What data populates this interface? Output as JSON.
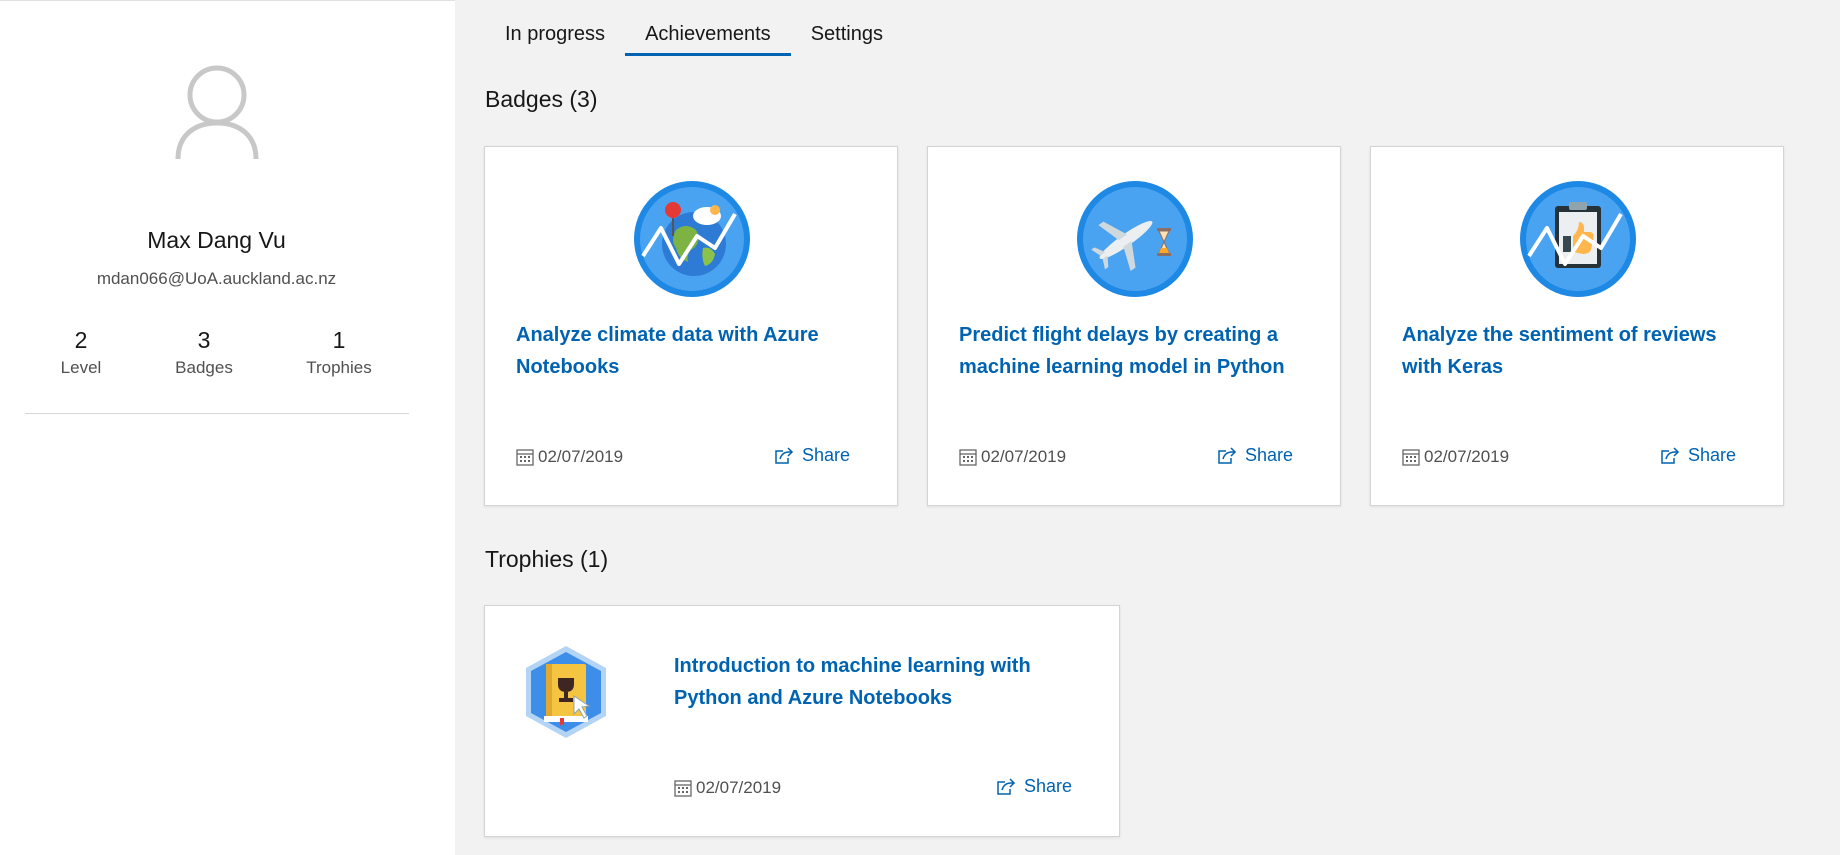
{
  "profile": {
    "name": "Max Dang Vu",
    "email": "mdan066@UoA.auckland.ac.nz",
    "stats": [
      {
        "value": "2",
        "label": "Level"
      },
      {
        "value": "3",
        "label": "Badges"
      },
      {
        "value": "1",
        "label": "Trophies"
      }
    ]
  },
  "tabs": [
    {
      "label": "In progress",
      "active": false
    },
    {
      "label": "Achievements",
      "active": true
    },
    {
      "label": "Settings",
      "active": false
    }
  ],
  "badges": {
    "heading": "Badges (3)",
    "items": [
      {
        "title": "Analyze climate data with Azure Notebooks",
        "date": "02/07/2019",
        "share": "Share",
        "icon": "climate-globe-icon"
      },
      {
        "title": "Predict flight delays by creating a machine learning model in Python",
        "date": "02/07/2019",
        "share": "Share",
        "icon": "airplane-hourglass-icon"
      },
      {
        "title": "Analyze the sentiment of reviews with Keras",
        "date": "02/07/2019",
        "share": "Share",
        "icon": "clipboard-thumbs-up-icon"
      }
    ]
  },
  "trophies": {
    "heading": "Trophies (1)",
    "items": [
      {
        "title": "Introduction to machine learning with Python and Azure Notebooks",
        "date": "02/07/2019",
        "share": "Share",
        "icon": "trophy-book-icon"
      }
    ]
  },
  "colors": {
    "accent": "#0063b1",
    "badge_blue": "#1e88e5",
    "page_bg": "#f2f2f2"
  }
}
